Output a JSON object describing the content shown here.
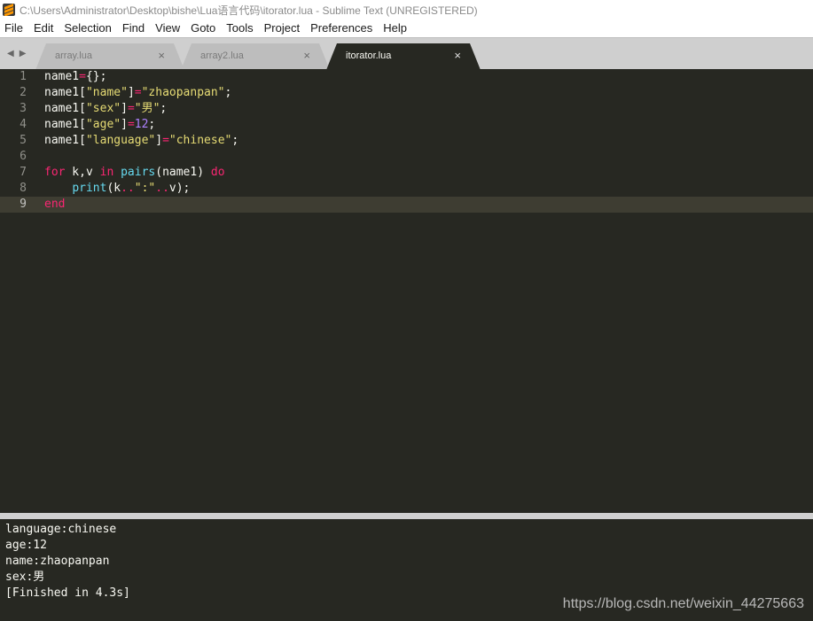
{
  "window": {
    "title": "C:\\Users\\Administrator\\Desktop\\bishe\\Lua语言代码\\itorator.lua - Sublime Text (UNREGISTERED)"
  },
  "menu": [
    "File",
    "Edit",
    "Selection",
    "Find",
    "View",
    "Goto",
    "Tools",
    "Project",
    "Preferences",
    "Help"
  ],
  "tabs": [
    {
      "label": "array.lua",
      "active": false
    },
    {
      "label": "array2.lua",
      "active": false
    },
    {
      "label": "itorator.lua",
      "active": true
    }
  ],
  "tab_nav": {
    "prev": "◀",
    "next": "▶"
  },
  "close_glyph": "×",
  "editor": {
    "current_line": 9,
    "line_numbers": [
      "1",
      "2",
      "3",
      "4",
      "5",
      "6",
      "7",
      "8",
      "9"
    ],
    "lines": [
      [
        {
          "t": "name1",
          "c": "plain"
        },
        {
          "t": "=",
          "c": "op"
        },
        {
          "t": "{};",
          "c": "plain"
        }
      ],
      [
        {
          "t": "name1[",
          "c": "plain"
        },
        {
          "t": "\"name\"",
          "c": "str"
        },
        {
          "t": "]",
          "c": "plain"
        },
        {
          "t": "=",
          "c": "op"
        },
        {
          "t": "\"zhaopanpan\"",
          "c": "str"
        },
        {
          "t": ";",
          "c": "plain"
        }
      ],
      [
        {
          "t": "name1[",
          "c": "plain"
        },
        {
          "t": "\"sex\"",
          "c": "str"
        },
        {
          "t": "]",
          "c": "plain"
        },
        {
          "t": "=",
          "c": "op"
        },
        {
          "t": "\"男\"",
          "c": "str"
        },
        {
          "t": ";",
          "c": "plain"
        }
      ],
      [
        {
          "t": "name1[",
          "c": "plain"
        },
        {
          "t": "\"age\"",
          "c": "str"
        },
        {
          "t": "]",
          "c": "plain"
        },
        {
          "t": "=",
          "c": "op"
        },
        {
          "t": "12",
          "c": "num"
        },
        {
          "t": ";",
          "c": "plain"
        }
      ],
      [
        {
          "t": "name1[",
          "c": "plain"
        },
        {
          "t": "\"language\"",
          "c": "str"
        },
        {
          "t": "]",
          "c": "plain"
        },
        {
          "t": "=",
          "c": "op"
        },
        {
          "t": "\"chinese\"",
          "c": "str"
        },
        {
          "t": ";",
          "c": "plain"
        }
      ],
      [],
      [
        {
          "t": "for",
          "c": "kw"
        },
        {
          "t": " k,v ",
          "c": "plain"
        },
        {
          "t": "in",
          "c": "kw"
        },
        {
          "t": " ",
          "c": "plain"
        },
        {
          "t": "pairs",
          "c": "fn"
        },
        {
          "t": "(name1) ",
          "c": "plain"
        },
        {
          "t": "do",
          "c": "kw"
        }
      ],
      [
        {
          "t": "    ",
          "c": "plain"
        },
        {
          "t": "print",
          "c": "fn"
        },
        {
          "t": "(k",
          "c": "plain"
        },
        {
          "t": "..",
          "c": "op"
        },
        {
          "t": "\":\"",
          "c": "str"
        },
        {
          "t": "..",
          "c": "op"
        },
        {
          "t": "v);",
          "c": "plain"
        }
      ],
      [
        {
          "t": "end",
          "c": "kw"
        }
      ]
    ]
  },
  "output": {
    "lines": [
      "language:chinese",
      "age:12",
      "name:zhaopanpan",
      "sex:男",
      "[Finished in 4.3s]"
    ]
  },
  "watermark": "https://blog.csdn.net/weixin_44275663",
  "colors": {
    "editor_bg": "#272822",
    "keyword": "#f92672",
    "string": "#e6db74",
    "number": "#ae81ff",
    "function": "#66d9ef"
  }
}
